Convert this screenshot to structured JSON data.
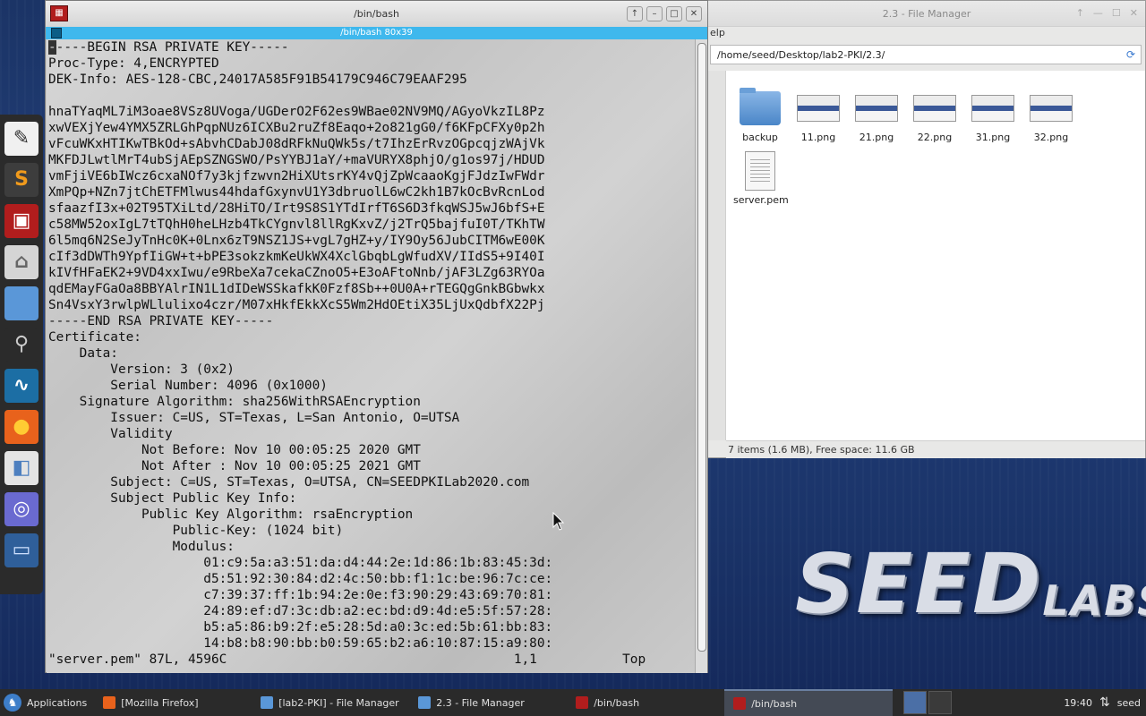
{
  "desktop": {
    "logo_big": "SEED",
    "logo_small": "LABS"
  },
  "dock": {
    "items": [
      {
        "name": "text-editor-icon",
        "glyph": "✎",
        "bg": "#f0f0f0",
        "fg": "#333"
      },
      {
        "name": "sublime-text-icon",
        "glyph": "S",
        "bg": "#3d3d3d",
        "fg": "#f09a1c"
      },
      {
        "name": "terminal-icon",
        "glyph": "▣",
        "bg": "#b11d1d",
        "fg": "#fff"
      },
      {
        "name": "home-folder-icon",
        "glyph": "⌂",
        "bg": "#d5d5d5",
        "fg": "#666"
      },
      {
        "name": "folder-icon",
        "glyph": "",
        "bg": "#5a97d8",
        "fg": "#fff"
      },
      {
        "name": "search-icon",
        "glyph": "⚲",
        "bg": "#2b2b2b",
        "fg": "#ccc"
      },
      {
        "name": "wireshark-icon",
        "glyph": "∿",
        "bg": "#1c6ea4",
        "fg": "#fff"
      },
      {
        "name": "firefox-icon",
        "glyph": "●",
        "bg": "#e8621c",
        "fg": "#ffcc33"
      },
      {
        "name": "settings-icon",
        "glyph": "◧",
        "bg": "#e4e4e4",
        "fg": "#4d7fbf"
      },
      {
        "name": "network-icon",
        "glyph": "◎",
        "bg": "#6a6ad0",
        "fg": "#fff"
      },
      {
        "name": "display-icon",
        "glyph": "▭",
        "bg": "#2f5f9a",
        "fg": "#cfe0ff"
      }
    ]
  },
  "file_manager": {
    "title": "2.3 - File Manager",
    "menu_fragment": "elp",
    "path": "/home/seed/Desktop/lab2-PKI/2.3/",
    "items": [
      {
        "label": "backup",
        "type": "folder"
      },
      {
        "label": "11.png",
        "type": "image"
      },
      {
        "label": "21.png",
        "type": "image"
      },
      {
        "label": "22.png",
        "type": "image"
      },
      {
        "label": "31.png",
        "type": "image"
      },
      {
        "label": "32.png",
        "type": "image"
      },
      {
        "label": "server.pem",
        "type": "document"
      }
    ],
    "status": "7 items (1.6 MB), Free space: 11.6 GB"
  },
  "terminal": {
    "title": "/bin/bash",
    "tab_label": "/bin/bash 80x39",
    "lines": [
      "-----BEGIN RSA PRIVATE KEY-----",
      "Proc-Type: 4,ENCRYPTED",
      "DEK-Info: AES-128-CBC,24017A585F91B54179C946C79EAAF295",
      "",
      "hnaTYaqML7iM3oae8VSz8UVoga/UGDerO2F62es9WBae02NV9MQ/AGyoVkzIL8Pz",
      "xwVEXjYew4YMX5ZRLGhPqpNUz6ICXBu2ruZf8Eaqo+2o821gG0/f6KFpCFXy0p2h",
      "vFcuWKxHTIKwTBkOd+sAbvhCDabJ08dRFkNuQWk5s/t7IhzErRvzOGpcqjzWAjVk",
      "MKFDJLwtlMrT4ubSjAEpSZNGSWO/PsYYBJ1aY/+maVURYX8phjO/g1os97j/HDUD",
      "vmFjiVE6bIWcz6cxaNOf7y3kjfzwvn2HiXUtsrKY4vQjZpWcaaoKgjFJdzIwFWdr",
      "XmPQp+NZn7jtChETFMlwus44hdafGxynvU1Y3dbruolL6wC2kh1B7kOcBvRcnLod",
      "sfaazfI3x+02T95TXiLtd/28HiTO/Irt9S8S1YTdIrfT6S6D3fkqWSJ5wJ6bfS+E",
      "c58MW52oxIgL7tTQhH0heLHzb4TkCYgnvl8llRgKxvZ/j2TrQ5bajfuI0T/TKhTW",
      "6l5mq6N2SeJyTnHc0K+0Lnx6zT9NSZ1JS+vgL7gHZ+y/IY9Oy56JubCITM6wE00K",
      "cIf3dDWTh9YpfIiGW+t+bPE3sokzkmKeUkWX4XclGbqbLgWfudXV/IIdS5+9I40I",
      "kIVfHFaEK2+9VD4xxIwu/e9RbeXa7cekaCZnoO5+E3oAFtoNnb/jAF3LZg63RYOa",
      "qdEMayFGaOa8BBYAlrIN1L1dIDeWSSkafkK0Fzf8Sb++0U0A+rTEGQgGnkBGbwkx",
      "Sn4VsxY3rwlpWLlulixo4czr/M07xHkfEkkXcS5Wm2HdOEtiX35LjUxQdbfX22Pj",
      "-----END RSA PRIVATE KEY-----",
      "Certificate:",
      "    Data:",
      "        Version: 3 (0x2)",
      "        Serial Number: 4096 (0x1000)",
      "    Signature Algorithm: sha256WithRSAEncryption",
      "        Issuer: C=US, ST=Texas, L=San Antonio, O=UTSA",
      "        Validity",
      "            Not Before: Nov 10 00:05:25 2020 GMT",
      "            Not After : Nov 10 00:05:25 2021 GMT",
      "        Subject: C=US, ST=Texas, O=UTSA, CN=SEEDPKILab2020.com",
      "        Subject Public Key Info:",
      "            Public Key Algorithm: rsaEncryption",
      "                Public-Key: (1024 bit)",
      "                Modulus:",
      "                    01:c9:5a:a3:51:da:d4:44:2e:1d:86:1b:83:45:3d:",
      "                    d5:51:92:30:84:d2:4c:50:bb:f1:1c:be:96:7c:ce:",
      "                    c7:39:37:ff:1b:94:2e:0e:f3:90:29:43:69:70:81:",
      "                    24:89:ef:d7:3c:db:a2:ec:bd:d9:4d:e5:5f:57:28:",
      "                    b5:a5:86:b9:2f:e5:28:5d:a0:3c:ed:5b:61:bb:83:",
      "                    14:b8:b8:90:bb:b0:59:65:b2:a6:10:87:15:a9:80:",
      "\"server.pem\" 87L, 4596C                                     1,1           Top"
    ]
  },
  "taskbar": {
    "apps_label": "Applications",
    "tasks": [
      {
        "label": "[Mozilla Firefox]",
        "icon_color": "#e8621c",
        "active": false
      },
      {
        "label": "[lab2-PKI] - File Manager",
        "icon_color": "#5a97d8",
        "active": false
      },
      {
        "label": "2.3 - File Manager",
        "icon_color": "#5a97d8",
        "active": false
      },
      {
        "label": "/bin/bash",
        "icon_color": "#b11d1d",
        "active": false
      },
      {
        "label": "/bin/bash",
        "icon_color": "#b11d1d",
        "active": true
      }
    ],
    "clock": "19:40",
    "user": "seed"
  }
}
